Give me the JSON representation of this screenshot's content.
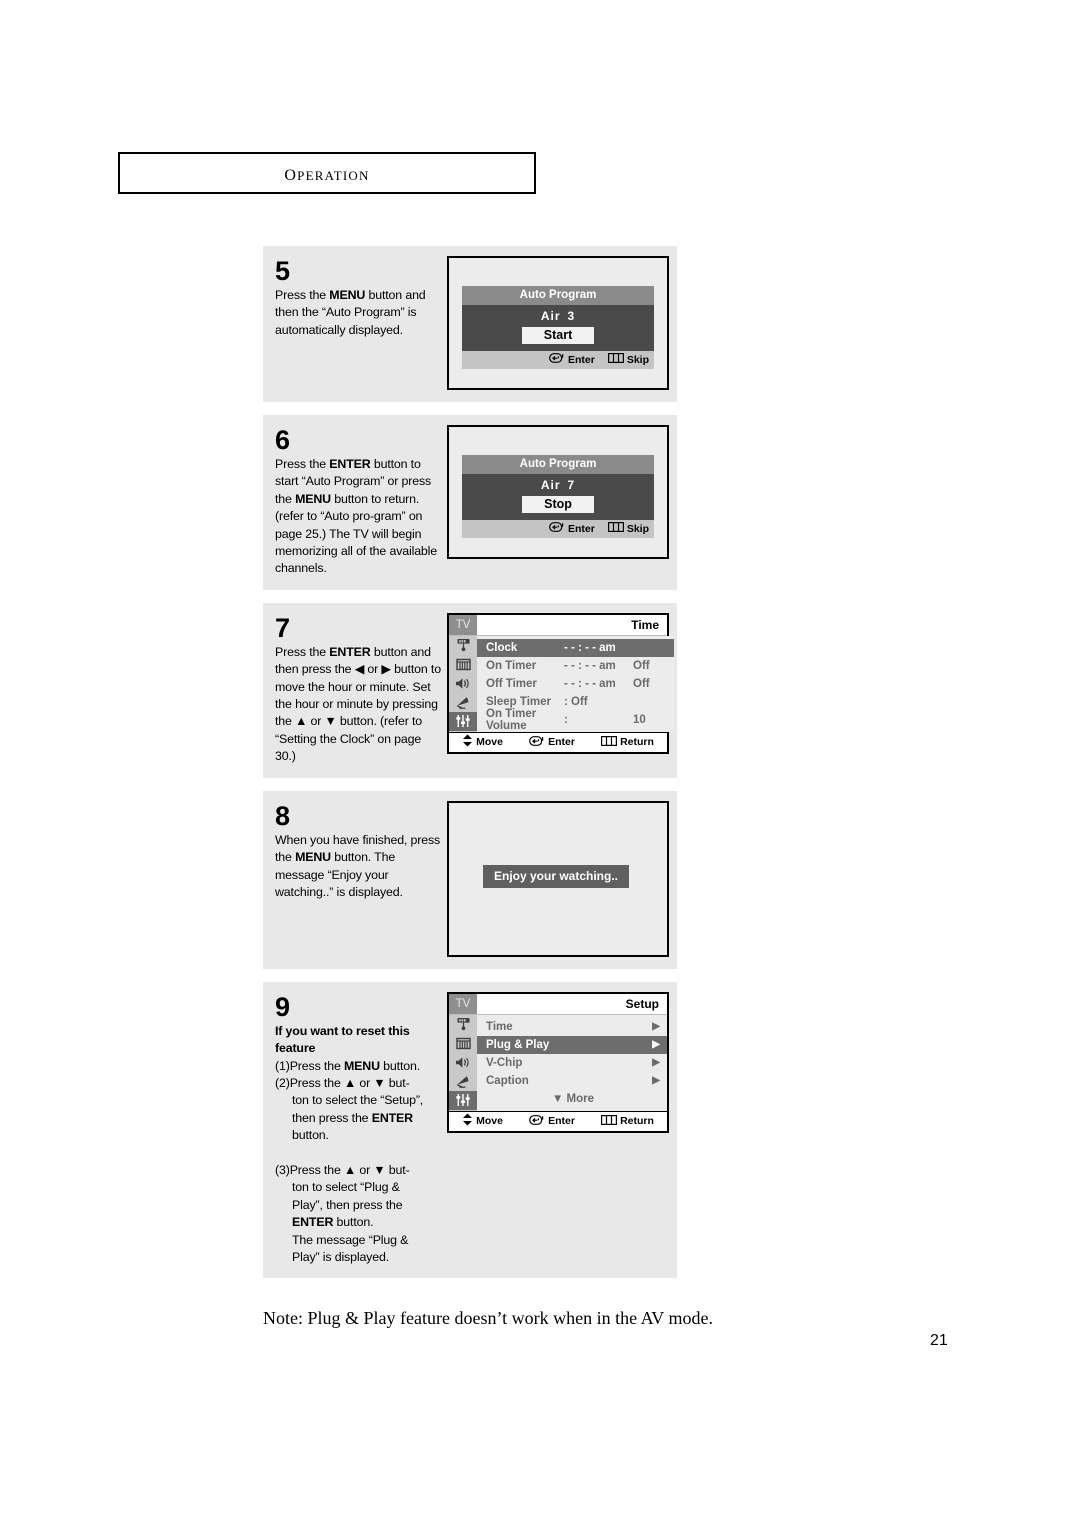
{
  "header": {
    "title": "Operation"
  },
  "steps": [
    {
      "number": "5",
      "text_html": "Press the <b>MENU</b> button and then the “Auto Program” is automatically displayed.",
      "visual": "auto-program",
      "osd": {
        "title": "Auto Program",
        "air_label": "Air",
        "air_value": "3",
        "button": "Start",
        "footer": [
          {
            "icon": "enter-icon",
            "label": "Enter"
          },
          {
            "icon": "skip-icon",
            "label": "Skip"
          }
        ]
      }
    },
    {
      "number": "6",
      "text_html": "Press the <b>ENTER</b> button to start “Auto Program” or press the <b>MENU</b> button to return. (refer to “Auto pro-gram” on page 25.) The TV will begin memorizing all of the available channels.",
      "visual": "auto-program",
      "osd": {
        "title": "Auto Program",
        "air_label": "Air",
        "air_value": "7",
        "button": "Stop",
        "footer": [
          {
            "icon": "enter-icon",
            "label": "Enter"
          },
          {
            "icon": "skip-icon",
            "label": "Skip"
          }
        ]
      }
    },
    {
      "number": "7",
      "text_html": "Press the <b>ENTER</b> button and then press the ◀ or ▶ button to move the hour or minute.  Set the hour or minute by pressing the ▲ or ▼ button. (refer to “Setting the Clock” on page 30.)",
      "visual": "tv-menu-time"
    },
    {
      "number": "8",
      "text_html": "When you have finished, press the <b>MENU</b> button. The message “Enjoy your watching..” is displayed.",
      "visual": "message",
      "message": "Enjoy your watching.."
    },
    {
      "number": "9",
      "text_html": "<b>If you want to reset this feature</b><br>(1)Press the <b>MENU</b> button.<br>(2)Press the ▲ or ▼ but-<span class=\"ind\">ton to select the “Setup”,</span><span class=\"ind\">then press the <b>ENTER</b></span><span class=\"ind\">button.</span><br>(3)Press the ▲ or ▼ but-<span class=\"ind\">ton to select “Plug &amp;</span><span class=\"ind\">Play”, then press the</span><span class=\"ind\"><b>ENTER</b> button.</span><span class=\"ind\">The message “Plug &amp;</span><span class=\"ind\">Play” is displayed.</span>",
      "visual": "tv-menu-setup"
    }
  ],
  "tv_menu_time": {
    "tv_label": "TV",
    "heading": "Time",
    "rail_icons": [
      "picture-icon",
      "channel-icon",
      "sound-icon",
      "satellite-icon",
      "setup-sliders-icon"
    ],
    "rail_active_index": 4,
    "rows": [
      {
        "label": "Clock",
        "value1": "- - : - - am",
        "value2": "",
        "selected": true
      },
      {
        "label": "On Timer",
        "value1": "- - : - - am",
        "value2": "Off",
        "selected": false
      },
      {
        "label": "Off Timer",
        "value1": "- - : - - am",
        "value2": "Off",
        "selected": false
      },
      {
        "label": "Sleep Timer",
        "value1": ": Off",
        "value2": "",
        "selected": false
      },
      {
        "label": "On Timer Volume",
        "value1": ":",
        "value2": "10",
        "selected": false
      }
    ],
    "footer": [
      {
        "icon": "move-icon",
        "label": "Move"
      },
      {
        "icon": "enter-icon",
        "label": "Enter"
      },
      {
        "icon": "return-icon",
        "label": "Return"
      }
    ]
  },
  "tv_menu_setup": {
    "tv_label": "TV",
    "heading": "Setup",
    "rail_icons": [
      "picture-icon",
      "channel-icon",
      "sound-icon",
      "satellite-icon",
      "setup-sliders-icon"
    ],
    "rail_active_index": 4,
    "rows": [
      {
        "label": "Time",
        "arrow": "▶",
        "selected": false
      },
      {
        "label": "Plug & Play",
        "arrow": "▶",
        "selected": true
      },
      {
        "label": "V-Chip",
        "arrow": "▶",
        "selected": false
      },
      {
        "label": "Caption",
        "arrow": "▶",
        "selected": false
      }
    ],
    "more_row": "▼ More",
    "footer": [
      {
        "icon": "move-icon",
        "label": "Move"
      },
      {
        "icon": "enter-icon",
        "label": "Enter"
      },
      {
        "icon": "return-icon",
        "label": "Return"
      }
    ]
  },
  "footer": {
    "note": "Note: Plug & Play feature doesn’t work when in the AV mode.",
    "page_number": "21"
  },
  "colors": {
    "step_bg": "#e8e8e8",
    "osd_title_bg": "#8a8a8a",
    "osd_body_bg": "#4a4a4a",
    "osd_footer_bg": "#c4c4c4",
    "menu_selected_bg": "#6d6d6d",
    "menu_rail_bg": "#c9c9c9",
    "menu_body_bg": "#ececec"
  }
}
